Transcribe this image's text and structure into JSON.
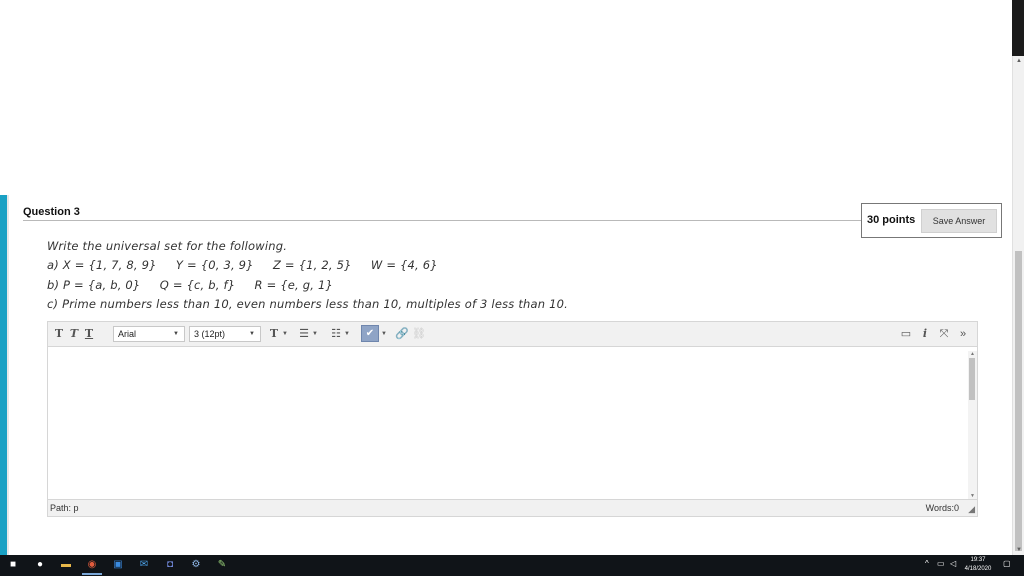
{
  "question": {
    "title": "Question 3",
    "points": "30 points",
    "save_label": "Save Answer",
    "lines": [
      "Write the universal set for the following.",
      "a) X = {1, 7, 8, 9}     Y = {0, 3, 9}     Z = {1, 2, 5}     W = {4, 6}",
      "b) P = {a, b, 0}     Q = {c, b, f}     R = {e, g, 1}",
      "c) Prime numbers less than 10, even numbers less than 10, multiples of 3 less than 10."
    ]
  },
  "editor": {
    "font_family_value": "Arial",
    "font_size_value": "3 (12pt)",
    "path_label": "Path: p",
    "words_label": "Words:0",
    "icons": [
      "bold-icon",
      "italic-icon",
      "underline-icon",
      "text-color-icon",
      "bullet-list-icon",
      "numbered-list-icon",
      "spellcheck-icon",
      "link-icon",
      "unlink-icon",
      "preview-icon",
      "info-icon",
      "fullscreen-icon",
      "expand-icon"
    ]
  },
  "taskbar": {
    "time": "19:37",
    "date": "4/18/2020",
    "apps": [
      "windows-start-icon",
      "search-icon",
      "file-explorer-icon",
      "chrome-icon",
      "outlook-icon",
      "mail-icon",
      "discord-icon",
      "settings-icon",
      "paint-icon"
    ]
  },
  "colors": {
    "accent_bar": "#1aa1c4",
    "taskbar_bg": "#101418"
  }
}
